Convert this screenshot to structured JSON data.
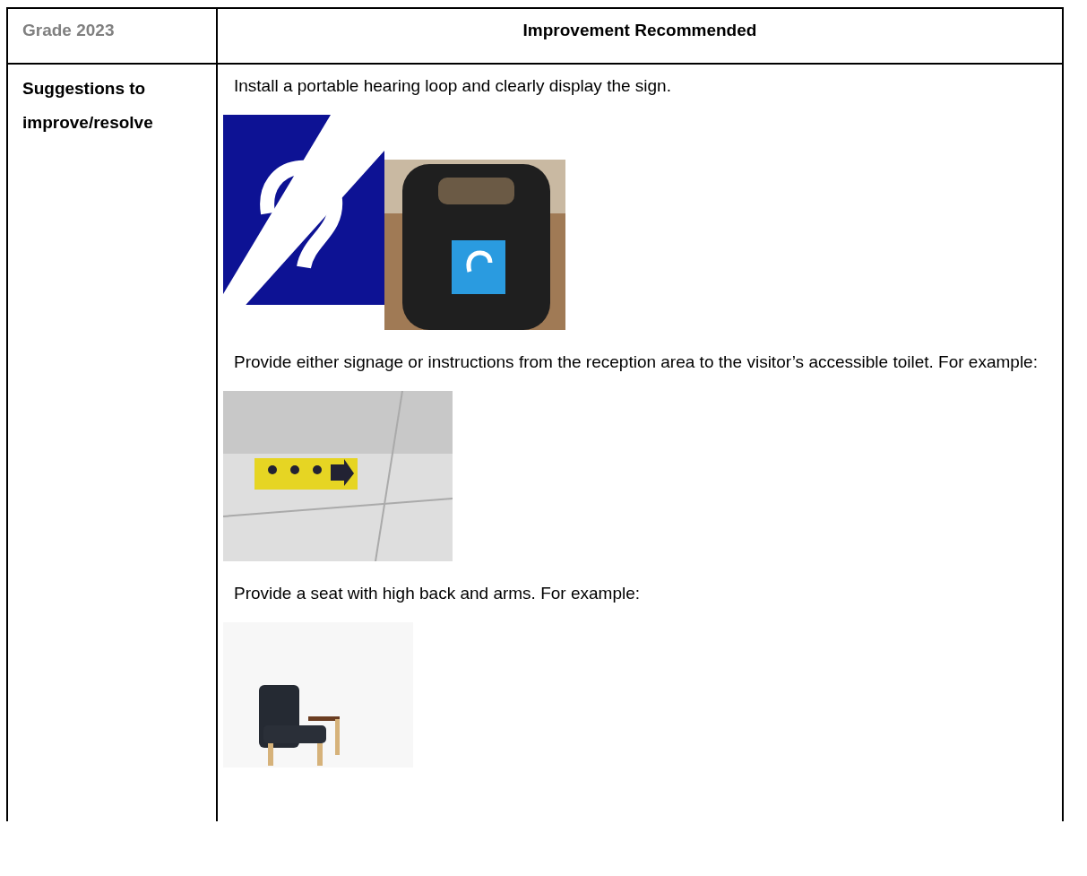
{
  "table": {
    "columns": [
      "Grade 2023",
      "Improvement Recommended"
    ],
    "rows": [
      {
        "heading": "Suggestions to improve/resolve",
        "blocks": [
          {
            "kind": "text",
            "text": "Install a portable hearing loop and clearly display the sign."
          },
          {
            "kind": "pictures"
          },
          {
            "kind": "text",
            "text": "Provide either signage or instructions from the reception area to the visitor’s accessible toilet. For example:"
          },
          {
            "kind": "pictures"
          },
          {
            "kind": "text",
            "text": "Provide a seat with high back and arms. For example:"
          },
          {
            "kind": "pictures"
          }
        ]
      }
    ]
  }
}
